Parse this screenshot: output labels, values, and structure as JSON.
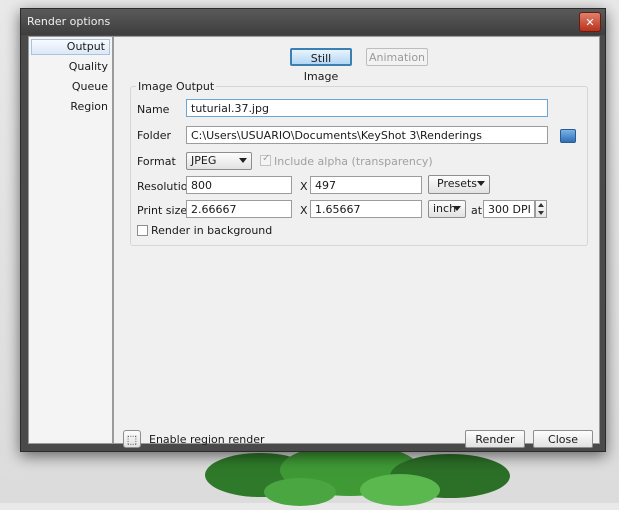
{
  "window": {
    "title": "Render options",
    "close_glyph": "✕"
  },
  "sidebar": {
    "items": [
      {
        "label": "Output"
      },
      {
        "label": "Quality"
      },
      {
        "label": "Queue"
      },
      {
        "label": "Region"
      }
    ]
  },
  "mode_tabs": {
    "still_image": "Still Image",
    "animation": "Animation"
  },
  "image_output": {
    "title": "Image Output",
    "name_label": "Name",
    "name_value": "tuturial.37.jpg",
    "folder_label": "Folder",
    "folder_value": "C:\\Users\\USUARIO\\Documents\\KeyShot 3\\Renderings",
    "format_label": "Format",
    "format_value": "JPEG",
    "include_alpha_label": "Include alpha (transparency)",
    "resolution_label": "Resolution",
    "resolution_width": "800",
    "resolution_x": "X",
    "resolution_height": "497",
    "presets_label": "Presets",
    "print_size_label": "Print size",
    "print_width": "2.66667",
    "print_x": "X",
    "print_height": "1.65667",
    "unit_value": "inch",
    "at_label": "at",
    "dpi_value": "300 DPI",
    "render_background_label": "Render in background"
  },
  "footer": {
    "enable_region_label": "Enable region render",
    "render_button": "Render",
    "close_button": "Close"
  },
  "colors": {
    "accent_border": "#3c7fb1",
    "title_bar": "#4a4a4a"
  }
}
